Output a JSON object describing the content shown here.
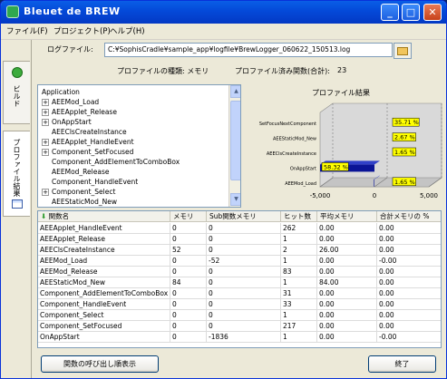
{
  "window": {
    "title": "Bleuet de BREW"
  },
  "menu": [
    "ファイル(F)",
    "プロジェクト(P)",
    "ヘルプ(H)"
  ],
  "left_tabs": {
    "build": "ビルド",
    "profile_results": "プロファイル結果"
  },
  "log_file": {
    "label": "ログファイル:",
    "value": "C:¥SophisCradle¥sample_app¥logfile¥BrewLogger_060622_150513.log"
  },
  "profile_info": {
    "type_label": "プロファイルの種類: メモリ",
    "count_label": "プロファイル済み関数(合計):",
    "count_value": "23"
  },
  "tree_items": [
    {
      "label": "Application",
      "expandable": false
    },
    {
      "label": "AEEMod_Load",
      "expandable": true
    },
    {
      "label": "AEEApplet_Release",
      "expandable": true
    },
    {
      "label": "OnAppStart",
      "expandable": true
    },
    {
      "label": "AEEClsCreateInstance",
      "expandable": false
    },
    {
      "label": "AEEApplet_HandleEvent",
      "expandable": true
    },
    {
      "label": "Component_SetFocused",
      "expandable": true
    },
    {
      "label": "Component_AddElementToComboBox",
      "expandable": false
    },
    {
      "label": "AEEMod_Release",
      "expandable": false
    },
    {
      "label": "Component_HandleEvent",
      "expandable": false
    },
    {
      "label": "Component_Select",
      "expandable": true
    },
    {
      "label": "AEEStaticMod_New",
      "expandable": false
    }
  ],
  "chart_data": {
    "type": "bar",
    "title": "プロファイル結果",
    "categories": [
      "SetFocusNextComponent",
      "AEEStaticMod_New",
      "AEEClsCreateInstance",
      "OnAppStart",
      "AEEMod_Load"
    ],
    "values": [
      35.71,
      2.67,
      1.65,
      58.32,
      1.65
    ],
    "value_labels": [
      "35.71 %",
      "2.67 %",
      "1.65 %",
      "58.32 %",
      "1.65 %"
    ],
    "bar_sizes": [
      0,
      0,
      0,
      -5000,
      -52
    ],
    "label_side": [
      "right",
      "right",
      "right",
      "left",
      "right"
    ],
    "xlim": [
      -5000,
      5000
    ],
    "x_ticks": [
      "-5,000",
      "0",
      "5,000"
    ],
    "colors": {
      "bar": "#0a1496",
      "label_bg": "#ffff00",
      "grid_bg": "#d9d9d9"
    }
  },
  "table": {
    "columns": [
      "関数名",
      "メモリ",
      "Sub関数メモリ",
      "ヒット数",
      "平均メモリ",
      "合計メモリの %"
    ],
    "rows": [
      [
        "AEEApplet_HandleEvent",
        "0",
        "0",
        "262",
        "0.00",
        "0.00"
      ],
      [
        "AEEApplet_Release",
        "0",
        "0",
        "1",
        "0.00",
        "0.00"
      ],
      [
        "AEEClsCreateInstance",
        "52",
        "0",
        "2",
        "26.00",
        "0.00"
      ],
      [
        "AEEMod_Load",
        "0",
        "-52",
        "1",
        "0.00",
        "-0.00"
      ],
      [
        "AEEMod_Release",
        "0",
        "0",
        "83",
        "0.00",
        "0.00"
      ],
      [
        "AEEStaticMod_New",
        "84",
        "0",
        "1",
        "84.00",
        "0.00"
      ],
      [
        "Component_AddElementToComboBox",
        "0",
        "0",
        "31",
        "0.00",
        "0.00"
      ],
      [
        "Component_HandleEvent",
        "0",
        "0",
        "33",
        "0.00",
        "0.00"
      ],
      [
        "Component_Select",
        "0",
        "0",
        "1",
        "0.00",
        "0.00"
      ],
      [
        "Component_SetFocused",
        "0",
        "0",
        "217",
        "0.00",
        "0.00"
      ],
      [
        "OnAppStart",
        "0",
        "-1836",
        "1",
        "0.00",
        "-0.00"
      ]
    ]
  },
  "buttons": {
    "call_order": "関数の呼び出し順表示",
    "exit": "終了"
  }
}
